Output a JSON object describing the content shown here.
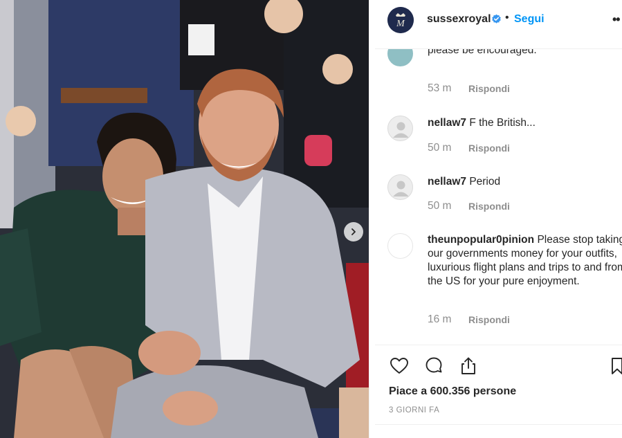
{
  "post": {
    "photo_alt": "Photo",
    "username": "sussexroyal",
    "dot": "•",
    "follow_label": "Segui",
    "more_label": "••"
  },
  "comments": [
    {
      "user": "",
      "text": "what you do. Continues blessings and please be encouraged.",
      "time": "53 m",
      "reply": "Rispondi",
      "avatar_color": "#8fbfc4"
    },
    {
      "user": "nellaw7",
      "text": "F the British...",
      "time": "50 m",
      "reply": "Rispondi",
      "avatar_color": "#ededed"
    },
    {
      "user": "nellaw7",
      "text": "Period",
      "time": "50 m",
      "reply": "Rispondi",
      "avatar_color": "#ededed"
    },
    {
      "user": "theunpopular0pinion",
      "text": "Please stop taking our governments money for your outfits, luxurious flight plans and trips to and from the US for your pure enjoyment.",
      "time": "16 m",
      "reply": "Rispondi",
      "avatar_color": "#ffffff"
    }
  ],
  "actions": {
    "like_icon": "heart-icon",
    "comment_icon": "comment-icon",
    "share_icon": "share-icon",
    "save_icon": "bookmark-icon",
    "likes_text": "Piace a 600.356 persone",
    "date_text": "3 GIORNI FA"
  },
  "colors": {
    "link": "#0095f6",
    "verified": "#3897f0",
    "muted": "#8e8e8e",
    "text": "#262626"
  }
}
